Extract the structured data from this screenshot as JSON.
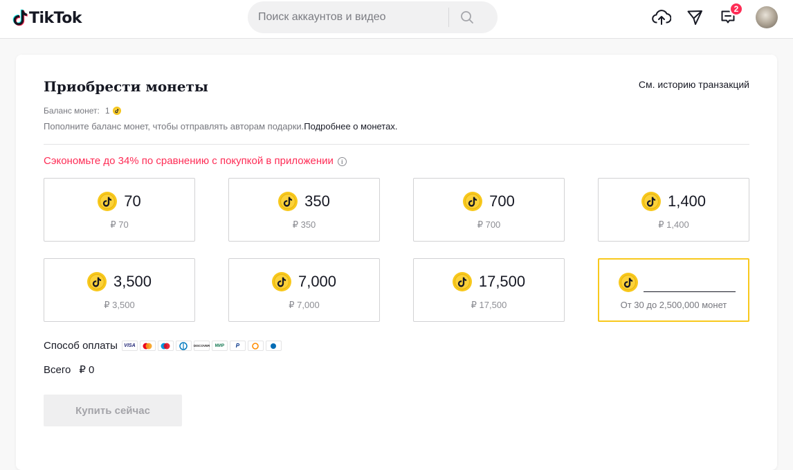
{
  "header": {
    "logo_text": "TikTok",
    "search": {
      "placeholder": "Поиск аккаунтов и видео"
    },
    "inbox_badge": "2"
  },
  "page": {
    "title": "Приобрести монеты",
    "history_link": "См. историю транзакций",
    "balance_label": "Баланс монет:",
    "balance_value": "1",
    "topup_text": "Пополните баланс монет, чтобы отправлять авторам подарки.",
    "topup_link": "Подробнее о монетах.",
    "save_notice": "Сэкономьте до 34% по сравнению с покупкой в приложении",
    "packages": [
      {
        "coins": "70",
        "price": "₽ 70"
      },
      {
        "coins": "350",
        "price": "₽ 350"
      },
      {
        "coins": "700",
        "price": "₽ 700"
      },
      {
        "coins": "1,400",
        "price": "₽ 1,400"
      },
      {
        "coins": "3,500",
        "price": "₽ 3,500"
      },
      {
        "coins": "7,000",
        "price": "₽ 7,000"
      },
      {
        "coins": "17,500",
        "price": "₽ 17,500"
      }
    ],
    "custom": {
      "value": "",
      "range_text": "От 30 до 2,500,000 монет"
    },
    "payment_label": "Способ оплаты",
    "payment_methods": [
      "VISA",
      "Mastercard",
      "Maestro",
      "Diners",
      "DISCOVER",
      "МИР",
      "PayPal",
      "Qiwi",
      "Webmoney"
    ],
    "total_label": "Всего",
    "total_value": "₽ 0",
    "buy_label": "Купить сейчас"
  },
  "colors": {
    "accent": "#fe2c55",
    "coin": "#f8c81c",
    "selected_border": "#f8c81c"
  }
}
